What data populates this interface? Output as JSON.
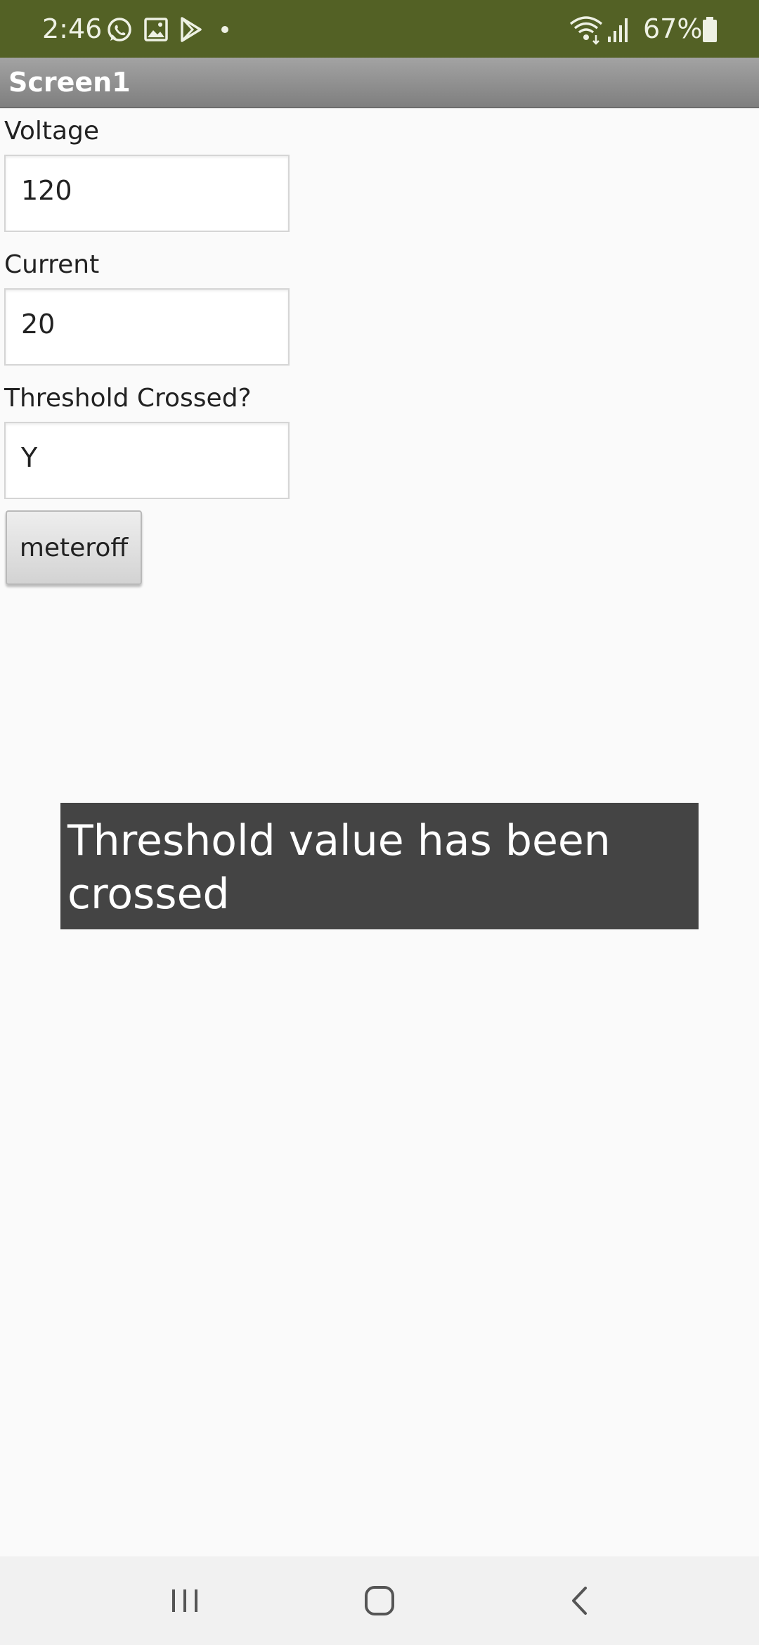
{
  "status_bar": {
    "time": "2:46",
    "battery_percent": "67%",
    "notification_icons": [
      "whatsapp-icon",
      "gallery-icon",
      "play-store-icon",
      "dot-icon"
    ],
    "system_icons": [
      "wifi-icon",
      "signal-icon",
      "battery-icon"
    ],
    "background_color": "#536125"
  },
  "app_bar": {
    "title": "Screen1"
  },
  "form": {
    "voltage": {
      "label": "Voltage",
      "value": "120"
    },
    "current": {
      "label": "Current",
      "value": "20"
    },
    "threshold": {
      "label": "Threshold Crossed?",
      "value": "Y"
    },
    "button_label": "meteroff"
  },
  "toast": {
    "message": "Threshold value has been crossed",
    "background_color": "#444444"
  },
  "nav_bar": {
    "icons": [
      "recent-apps-icon",
      "home-icon",
      "back-icon"
    ]
  }
}
